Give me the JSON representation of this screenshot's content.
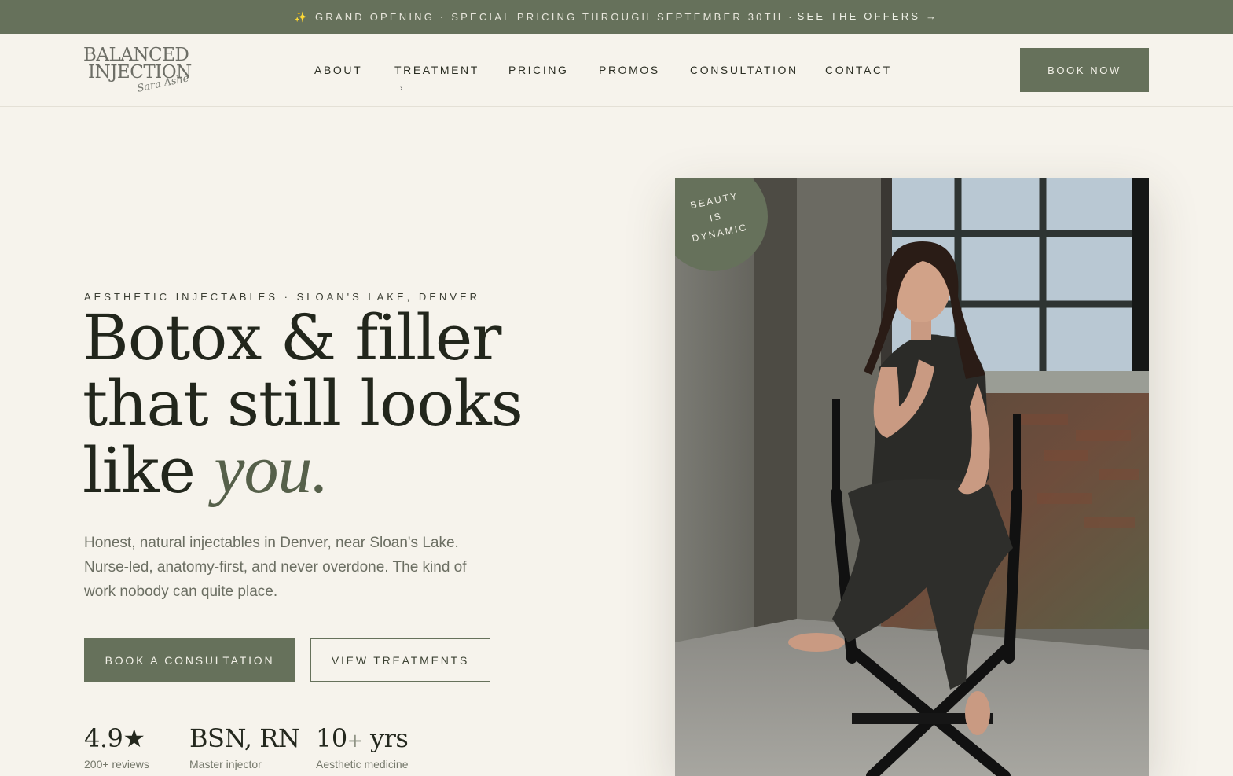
{
  "announcement": {
    "text": "GRAND OPENING · SPECIAL PRICING THROUGH SEPTEMBER 30TH ·",
    "link": "SEE THE OFFERS →",
    "icon": "sparkle-icon"
  },
  "header": {
    "logo": {
      "line1": "BALANCED",
      "line2": "INJECTION",
      "signature": "Sara Ashe"
    },
    "nav": [
      "ABOUT",
      "TREATMENT",
      "PRICING",
      "PROMOS",
      "CONSULTATION",
      "CONTACT"
    ],
    "treatment_caret": "›",
    "book_now": "BOOK NOW"
  },
  "hero": {
    "eyebrow": "AESTHETIC INJECTABLES · SLOAN'S LAKE, DENVER",
    "headline_line1": "Botox & filler",
    "headline_line2": "that still looks",
    "headline_line3_plain": "like ",
    "headline_line3_italic": "you.",
    "lede": "Honest, natural injectables in Denver, near Sloan's Lake. Nurse-led, anatomy-first, and never overdone. The kind of work nobody can quite place.",
    "cta_primary": "BOOK A CONSULTATION",
    "cta_secondary": "VIEW TREATMENTS",
    "stats": [
      {
        "value": "4.9★",
        "label": "200+ reviews"
      },
      {
        "value": "BSN, RN",
        "label": "Master injector"
      },
      {
        "value": "10",
        "suffix": "+",
        "unit": " yrs",
        "label": "Aesthetic medicine"
      }
    ],
    "badge": {
      "line1": "BEAUTY",
      "line2": "IS",
      "line3": "DYNAMIC"
    }
  },
  "colors": {
    "brand_green": "#66715b",
    "background": "#f6f3ec",
    "text_dark": "#22261c"
  }
}
